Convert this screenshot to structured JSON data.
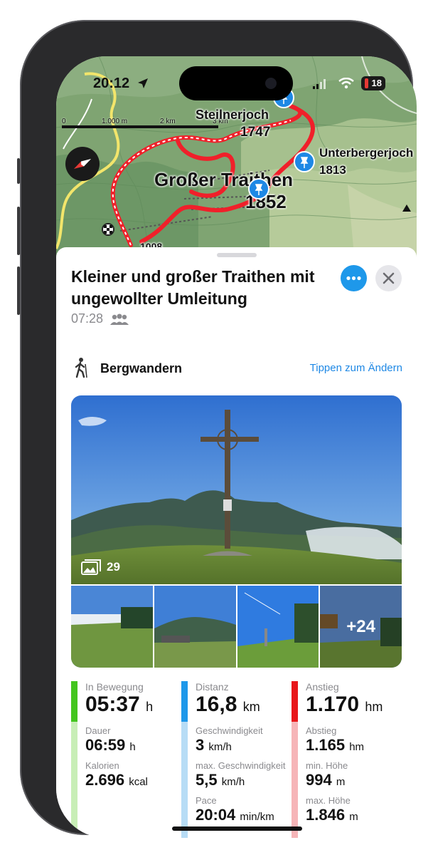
{
  "status": {
    "time": "20:12",
    "battery": "18"
  },
  "map": {
    "scale": [
      "0",
      "1.000 m",
      "2 km",
      "3 km"
    ],
    "labels": {
      "steilnerjoch": "Steilnerjoch",
      "steilnerjoch_alt": "1747",
      "unterbergerjoch": "Unterbergerjoch",
      "unterbergerjoch_alt": "1813",
      "grosser_traithen": "Großer Traithen",
      "grosser_traithen_alt": "1852",
      "bottom_alt": "1008"
    }
  },
  "sheet": {
    "title": "Kleiner und großer Traithen mit ungewollter Umleitung",
    "duration": "07:28",
    "activity": "Bergwandern",
    "change_link": "Tippen zum Ändern",
    "photo_count": "29",
    "more_photos": "+24"
  },
  "stats": {
    "col1": {
      "moving_label": "In Bewegung",
      "moving_value": "05:37",
      "moving_unit": "h",
      "dauer_label": "Dauer",
      "dauer_value": "06:59",
      "dauer_unit": "h",
      "kal_label": "Kalorien",
      "kal_value": "2.696",
      "kal_unit": "kcal"
    },
    "col2": {
      "dist_label": "Distanz",
      "dist_value": "16,8",
      "dist_unit": "km",
      "speed_label": "Geschwindigkeit",
      "speed_value": "3",
      "speed_unit": "km/h",
      "maxspeed_label": "max. Geschwindigkeit",
      "maxspeed_value": "5,5",
      "maxspeed_unit": "km/h",
      "pace_label": "Pace",
      "pace_value": "20:04",
      "pace_unit": "min/km"
    },
    "col3": {
      "asc_label": "Anstieg",
      "asc_value": "1.170",
      "asc_unit": "hm",
      "desc_label": "Abstieg",
      "desc_value": "1.165",
      "desc_unit": "hm",
      "min_label": "min. Höhe",
      "min_value": "994",
      "min_unit": "m",
      "max_label": "max. Höhe",
      "max_value": "1.846",
      "max_unit": "m"
    }
  },
  "colors": {
    "green": "#43c51e",
    "green_light": "#c8eeb6",
    "blue": "#1e98ea",
    "blue_light": "#b7dcf6",
    "red": "#e8171b",
    "red_light": "#f6b5b8",
    "route": "#f0202a"
  },
  "icons": [
    "location-arrow-icon",
    "signal-icon",
    "wifi-icon",
    "battery-icon",
    "compass-icon",
    "pin-icon",
    "finish-flag-icon",
    "more-icon",
    "close-icon",
    "hiker-icon",
    "group-icon",
    "gallery-icon"
  ]
}
